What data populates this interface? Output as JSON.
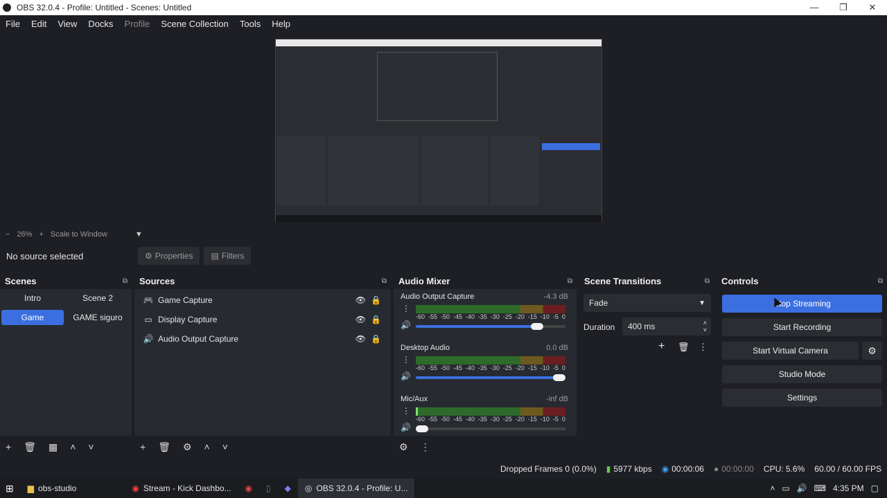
{
  "window": {
    "title": "OBS 32.0.4 - Profile: Untitled - Scenes: Untitled",
    "minimize": "—",
    "maximize": "❐",
    "close": "✕"
  },
  "menu": [
    "File",
    "Edit",
    "View",
    "Docks",
    "Profile",
    "Scene Collection",
    "Tools",
    "Help"
  ],
  "zoom": {
    "minus": "−",
    "level": "26%",
    "plus": "+",
    "mode": "Scale to Window",
    "arrow": "▼"
  },
  "source_bar": {
    "status": "No source selected",
    "properties": "Properties",
    "filters": "Filters"
  },
  "scenes": {
    "title": "Scenes",
    "items": [
      "Intro",
      "Scene 2",
      "Game",
      "GAME siguro"
    ],
    "active": "Game"
  },
  "sources": {
    "title": "Sources",
    "items": [
      {
        "label": "Game Capture",
        "icon": "gamepad-icon",
        "locked": false
      },
      {
        "label": "Display Capture",
        "icon": "monitor-icon",
        "locked": true
      },
      {
        "label": "Audio Output Capture",
        "icon": "speaker-icon",
        "locked": false
      }
    ]
  },
  "audio_mixer": {
    "title": "Audio Mixer",
    "scale": [
      "-60",
      "-55",
      "-50",
      "-45",
      "-40",
      "-35",
      "-30",
      "-25",
      "-20",
      "-15",
      "-10",
      "-5",
      "0"
    ],
    "channels": [
      {
        "name": "Audio Output Capture",
        "db": "-4.3 dB",
        "volume": 0.84
      },
      {
        "name": "Desktop Audio",
        "db": "0.0 dB",
        "volume": 1.0
      },
      {
        "name": "Mic/Aux",
        "db": "-inf dB",
        "volume": 0.0
      }
    ]
  },
  "transitions": {
    "title": "Scene Transitions",
    "selected": "Fade",
    "duration_label": "Duration",
    "duration": "400 ms"
  },
  "controls": {
    "title": "Controls",
    "buttons": [
      "Stop Streaming",
      "Start Recording",
      "Start Virtual Camera",
      "Studio Mode",
      "Settings"
    ]
  },
  "status": {
    "dropped": "Dropped Frames 0 (0.0%)",
    "bitrate": "5977 kbps",
    "stream_time": "00:00:06",
    "record_time": "00:00:00",
    "cpu": "CPU: 5.6%",
    "fps": "60.00 / 60.00 FPS"
  },
  "taskbar": {
    "items": [
      "obs-studio",
      "Stream - Kick Dashbo...",
      "OBS 32.0.4 - Profile: U..."
    ],
    "time": "4:35 PM"
  },
  "colors": {
    "accent": "#3b6fe0",
    "bg": "#1e1f24",
    "panel": "#272a30"
  }
}
